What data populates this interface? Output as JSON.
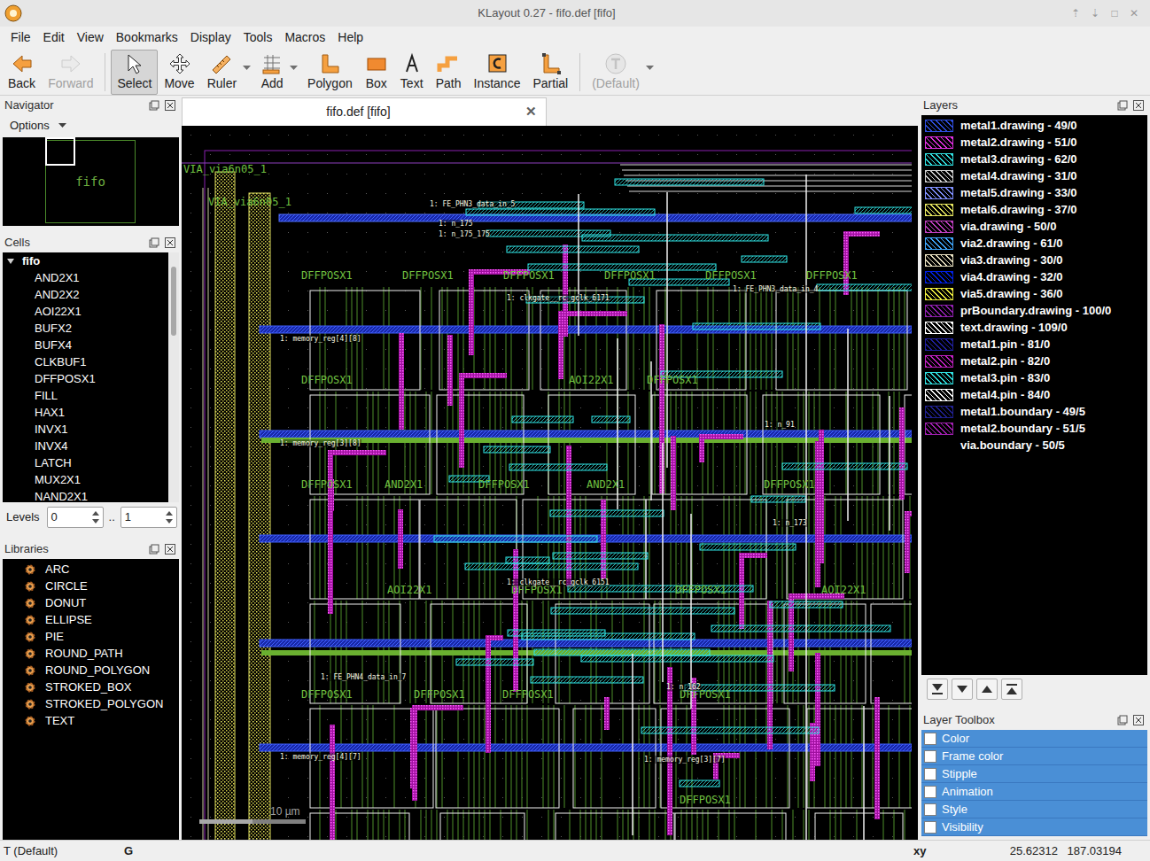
{
  "window": {
    "title": "KLayout 0.27 - fifo.def [fifo]",
    "controls": [
      "⇡",
      "⇣",
      "□",
      "✕"
    ]
  },
  "menu": [
    "File",
    "Edit",
    "View",
    "Bookmarks",
    "Display",
    "Tools",
    "Macros",
    "Help"
  ],
  "toolbar": [
    {
      "label": "Back",
      "selected": false,
      "disabled": false,
      "has_menu": false
    },
    {
      "label": "Forward",
      "selected": false,
      "disabled": true,
      "has_menu": false
    },
    {
      "label": "Select",
      "selected": true,
      "disabled": false,
      "has_menu": false
    },
    {
      "label": "Move",
      "selected": false,
      "disabled": false,
      "has_menu": false
    },
    {
      "label": "Ruler",
      "selected": false,
      "disabled": false,
      "has_menu": true
    },
    {
      "label": "Add",
      "selected": false,
      "disabled": false,
      "has_menu": true
    },
    {
      "label": "Polygon",
      "selected": false,
      "disabled": false,
      "has_menu": false
    },
    {
      "label": "Box",
      "selected": false,
      "disabled": false,
      "has_menu": false
    },
    {
      "label": "Text",
      "selected": false,
      "disabled": false,
      "has_menu": false
    },
    {
      "label": "Path",
      "selected": false,
      "disabled": false,
      "has_menu": false
    },
    {
      "label": "Instance",
      "selected": false,
      "disabled": false,
      "has_menu": false
    },
    {
      "label": "Partial",
      "selected": false,
      "disabled": false,
      "has_menu": false
    },
    {
      "label": "(Default)",
      "selected": false,
      "disabled": true,
      "has_menu": true
    }
  ],
  "navigator": {
    "title": "Navigator",
    "options": "Options",
    "cell": "fifo"
  },
  "cells": {
    "title": "Cells",
    "root": {
      "name": "fifo",
      "expanded": true
    },
    "items": [
      "AND2X1",
      "AND2X2",
      "AOI22X1",
      "BUFX2",
      "BUFX4",
      "CLKBUF1",
      "DFFPOSX1",
      "FILL",
      "HAX1",
      "INVX1",
      "INVX4",
      "LATCH",
      "MUX2X1",
      "NAND2X1"
    ]
  },
  "levels": {
    "label": "Levels",
    "from": "0",
    "separator": "..",
    "to": "1"
  },
  "libraries": {
    "title": "Libraries",
    "items": [
      "ARC",
      "CIRCLE",
      "DONUT",
      "ELLIPSE",
      "PIE",
      "ROUND_PATH",
      "ROUND_POLYGON",
      "STROKED_BOX",
      "STROKED_POLYGON",
      "TEXT"
    ]
  },
  "document_tab": {
    "label": "fifo.def [fifo]",
    "close": "✕"
  },
  "canvas": {
    "scale": "10 µm",
    "labels": [
      "VIA_via6n05_1",
      "VIA_via6n05_1",
      "DFFPOSX1",
      "DFFPOSX1",
      "DFFPOSX1",
      "DFFPOSX1",
      "DFFPOSX1",
      "DFFPOSX1",
      "DFFPOSX1",
      "AOI22X1",
      "DFFPOSX1",
      "DFFPOSX1",
      "AND2X1",
      "DFFPOSX1",
      "AND2X1",
      "DFFPOSX1",
      "AOI22X1",
      "DFFPOSX1",
      "DFFPOSX1",
      "AOI22X1",
      "DFFPOSX1",
      "DFFPOSX1",
      "DFFPOSX1",
      "DFFPOSX1",
      "DFFPOSX1"
    ],
    "nets": [
      "1: FE_PHN3_data_in_5",
      "1: n_175",
      "1: n_175_175",
      "1: memory_reg[4][8]",
      "1: clkgate__rc_gclk_6171",
      "1: FE_PHN3_data_in_4",
      "1: memory_reg[3][8]",
      "1: n_91",
      "1: clkgate__rc_gclk_6151",
      "1: memory_reg[4][7]",
      "1: FE_PHN4_data_in_7",
      "1: n_173",
      "1: n_162",
      "1: memory_reg[3][7]"
    ]
  },
  "layers": {
    "title": "Layers",
    "items": [
      {
        "name": "metal1.drawing - 49/0",
        "color": "#2f4fe0"
      },
      {
        "name": "metal2.drawing - 51/0",
        "color": "#e030e0"
      },
      {
        "name": "metal3.drawing - 62/0",
        "color": "#30e0e0"
      },
      {
        "name": "metal4.drawing - 31/0",
        "color": "#d0d0d0"
      },
      {
        "name": "metal5.drawing - 33/0",
        "color": "#8090ff"
      },
      {
        "name": "metal6.drawing - 37/0",
        "color": "#e8e860"
      },
      {
        "name": "via.drawing - 50/0",
        "color": "#c040c0"
      },
      {
        "name": "via2.drawing - 61/0",
        "color": "#40a8ff"
      },
      {
        "name": "via3.drawing - 30/0",
        "color": "#e8e0c0"
      },
      {
        "name": "via4.drawing - 32/0",
        "color": "#0020e0"
      },
      {
        "name": "via5.drawing - 36/0",
        "color": "#f0f040"
      },
      {
        "name": "prBoundary.drawing - 100/0",
        "color": "#9020b0"
      },
      {
        "name": "text.drawing - 109/0",
        "color": "#ffffff"
      },
      {
        "name": "metal1.pin - 81/0",
        "color": "#2020a0"
      },
      {
        "name": "metal2.pin - 82/0",
        "color": "#c020c0"
      },
      {
        "name": "metal3.pin - 83/0",
        "color": "#30e0e0"
      },
      {
        "name": "metal4.pin - 84/0",
        "color": "#ffffff"
      },
      {
        "name": "metal1.boundary - 49/5",
        "color": "#202090"
      },
      {
        "name": "metal2.boundary - 51/5",
        "color": "#a020b0"
      },
      {
        "name": "via.boundary - 50/5",
        "color": "#000000"
      }
    ]
  },
  "layer_toolbox": {
    "title": "Layer Toolbox",
    "items": [
      {
        "label": "Color",
        "checked": false
      },
      {
        "label": "Frame color",
        "checked": false
      },
      {
        "label": "Stipple",
        "checked": false
      },
      {
        "label": "Animation",
        "checked": false
      },
      {
        "label": "Style",
        "checked": false
      },
      {
        "label": "Visibility",
        "checked": false
      }
    ]
  },
  "status_bar": {
    "mode": "T (Default)",
    "grid": "G",
    "xy_label": "xy",
    "x": "25.62312",
    "y": "187.03194"
  }
}
